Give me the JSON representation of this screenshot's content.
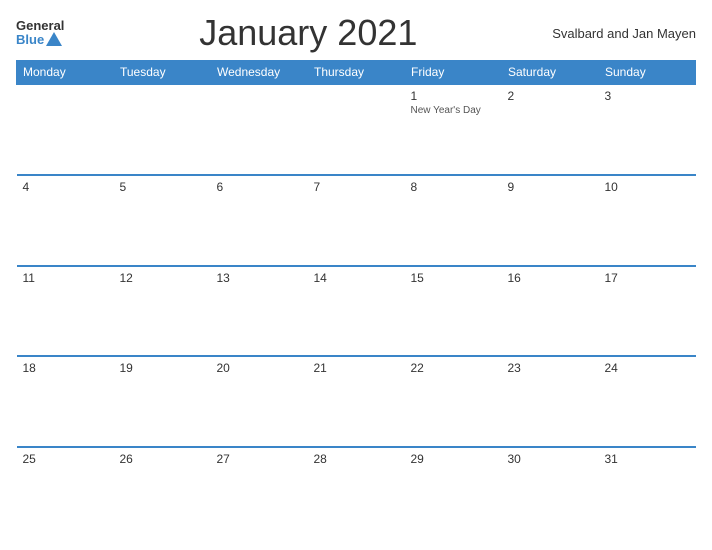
{
  "logo": {
    "general": "General",
    "blue": "Blue"
  },
  "title": "January 2021",
  "region": "Svalbard and Jan Mayen",
  "days_header": [
    "Monday",
    "Tuesday",
    "Wednesday",
    "Thursday",
    "Friday",
    "Saturday",
    "Sunday"
  ],
  "weeks": [
    [
      {
        "day": "",
        "holiday": ""
      },
      {
        "day": "",
        "holiday": ""
      },
      {
        "day": "",
        "holiday": ""
      },
      {
        "day": "",
        "holiday": ""
      },
      {
        "day": "1",
        "holiday": "New Year's Day"
      },
      {
        "day": "2",
        "holiday": ""
      },
      {
        "day": "3",
        "holiday": ""
      }
    ],
    [
      {
        "day": "4",
        "holiday": ""
      },
      {
        "day": "5",
        "holiday": ""
      },
      {
        "day": "6",
        "holiday": ""
      },
      {
        "day": "7",
        "holiday": ""
      },
      {
        "day": "8",
        "holiday": ""
      },
      {
        "day": "9",
        "holiday": ""
      },
      {
        "day": "10",
        "holiday": ""
      }
    ],
    [
      {
        "day": "11",
        "holiday": ""
      },
      {
        "day": "12",
        "holiday": ""
      },
      {
        "day": "13",
        "holiday": ""
      },
      {
        "day": "14",
        "holiday": ""
      },
      {
        "day": "15",
        "holiday": ""
      },
      {
        "day": "16",
        "holiday": ""
      },
      {
        "day": "17",
        "holiday": ""
      }
    ],
    [
      {
        "day": "18",
        "holiday": ""
      },
      {
        "day": "19",
        "holiday": ""
      },
      {
        "day": "20",
        "holiday": ""
      },
      {
        "day": "21",
        "holiday": ""
      },
      {
        "day": "22",
        "holiday": ""
      },
      {
        "day": "23",
        "holiday": ""
      },
      {
        "day": "24",
        "holiday": ""
      }
    ],
    [
      {
        "day": "25",
        "holiday": ""
      },
      {
        "day": "26",
        "holiday": ""
      },
      {
        "day": "27",
        "holiday": ""
      },
      {
        "day": "28",
        "holiday": ""
      },
      {
        "day": "29",
        "holiday": ""
      },
      {
        "day": "30",
        "holiday": ""
      },
      {
        "day": "31",
        "holiday": ""
      }
    ]
  ]
}
